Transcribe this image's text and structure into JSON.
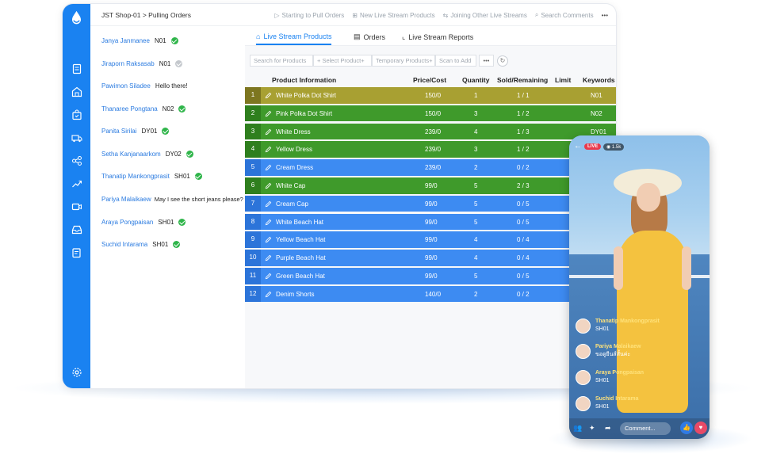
{
  "breadcrumb": "JST Shop-01 > Pulling Orders",
  "top_actions": [
    {
      "icon": "play-circle-icon",
      "label": "Starting to Pull Orders"
    },
    {
      "icon": "plus-square-icon",
      "label": "New Live Stream Products"
    },
    {
      "icon": "link-icon",
      "label": "Joining Other Live Streams"
    },
    {
      "icon": "search-icon",
      "label": "Search Comments"
    }
  ],
  "more_label": "•••",
  "comments": [
    {
      "name": "Janya Janmanee",
      "code": "N01",
      "status": "ok"
    },
    {
      "name": "Jiraporn Raksasab",
      "code": "N01",
      "status": "pending"
    },
    {
      "name": "Pawimon Siladee",
      "code": "Hello there!",
      "status": "none"
    },
    {
      "name": "Thanaree Pongtana",
      "code": "N02",
      "status": "ok"
    },
    {
      "name": "Panita Sirilai",
      "code": "DY01",
      "status": "ok"
    },
    {
      "name": "Setha Kanjanaarkom",
      "code": "DY02",
      "status": "ok"
    },
    {
      "name": "Thanatip Mankongprasit",
      "code": "SH01",
      "status": "ok"
    },
    {
      "name": "Pariya Malaikaew",
      "code": "May I see the short jeans please?",
      "status": "none"
    },
    {
      "name": "Araya Pongpaisan",
      "code": "SH01",
      "status": "ok"
    },
    {
      "name": "Suchid Intarama",
      "code": "SH01",
      "status": "ok"
    }
  ],
  "tabs": [
    {
      "label": "Live Stream Products",
      "icon": "live-icon",
      "active": true
    },
    {
      "label": "Orders",
      "icon": "document-icon",
      "active": false
    },
    {
      "label": "Live Stream Reports",
      "icon": "chart-icon",
      "active": false
    }
  ],
  "toolbar": {
    "search_placeholder": "Search for Products",
    "select_product": "+ Select Product+",
    "temporary_products": "Temporary Products+",
    "scan_to_add": "Scan to Add",
    "more": "•••"
  },
  "table": {
    "headers": [
      "Product Information",
      "Price/Cost",
      "Quantity",
      "Sold/Remaining",
      "Limit",
      "Keywords"
    ],
    "rows": [
      {
        "no": "1",
        "name": "White Polka Dot Shirt",
        "price": "150/0",
        "qty": "1",
        "sold": "1 / 1",
        "limit": "",
        "keyword": "N01",
        "color": "olive"
      },
      {
        "no": "2",
        "name": "Pink Polka Dot Shirt",
        "price": "150/0",
        "qty": "3",
        "sold": "1 / 2",
        "limit": "",
        "keyword": "N02",
        "color": "green"
      },
      {
        "no": "3",
        "name": "White Dress",
        "price": "239/0",
        "qty": "4",
        "sold": "1 / 3",
        "limit": "",
        "keyword": "DY01",
        "color": "green"
      },
      {
        "no": "4",
        "name": "Yellow Dress",
        "price": "239/0",
        "qty": "3",
        "sold": "1 / 2",
        "limit": "",
        "keyword": "",
        "color": "green"
      },
      {
        "no": "5",
        "name": "Cream Dress",
        "price": "239/0",
        "qty": "2",
        "sold": "0 / 2",
        "limit": "",
        "keyword": "",
        "color": "blue"
      },
      {
        "no": "6",
        "name": "White Cap",
        "price": "99/0",
        "qty": "5",
        "sold": "2 / 3",
        "limit": "",
        "keyword": "",
        "color": "green"
      },
      {
        "no": "7",
        "name": "Cream Cap",
        "price": "99/0",
        "qty": "5",
        "sold": "0 / 5",
        "limit": "",
        "keyword": "",
        "color": "blue"
      },
      {
        "no": "8",
        "name": "White Beach Hat",
        "price": "99/0",
        "qty": "5",
        "sold": "0 / 5",
        "limit": "",
        "keyword": "",
        "color": "blue"
      },
      {
        "no": "9",
        "name": "Yellow Beach Hat",
        "price": "99/0",
        "qty": "4",
        "sold": "0 / 4",
        "limit": "",
        "keyword": "",
        "color": "blue"
      },
      {
        "no": "10",
        "name": "Purple Beach Hat",
        "price": "99/0",
        "qty": "4",
        "sold": "0 / 4",
        "limit": "",
        "keyword": "",
        "color": "blue"
      },
      {
        "no": "11",
        "name": "Green Beach Hat",
        "price": "99/0",
        "qty": "5",
        "sold": "0 / 5",
        "limit": "",
        "keyword": "",
        "color": "blue"
      },
      {
        "no": "12",
        "name": "Denim Shorts",
        "price": "140/0",
        "qty": "2",
        "sold": "0 / 2",
        "limit": "",
        "keyword": "",
        "color": "blue"
      }
    ]
  },
  "phone": {
    "live_badge": "LIVE",
    "viewers": "1.5k",
    "comments": [
      {
        "name": "Thanatip Mankongprasit",
        "text": "SH01"
      },
      {
        "name": "Pariya Malaikaew",
        "text": "ขอดูยีนส์สั้นค่ะ"
      },
      {
        "name": "Araya Pongpaisan",
        "text": "SH01"
      },
      {
        "name": "Suchid Intarama",
        "text": "SH01"
      }
    ],
    "comment_placeholder": "Comment..."
  },
  "colors": {
    "brand": "#1a82f1",
    "olive": "#a8a032",
    "green": "#3f9a2b",
    "blue": "#3d8bf2"
  }
}
